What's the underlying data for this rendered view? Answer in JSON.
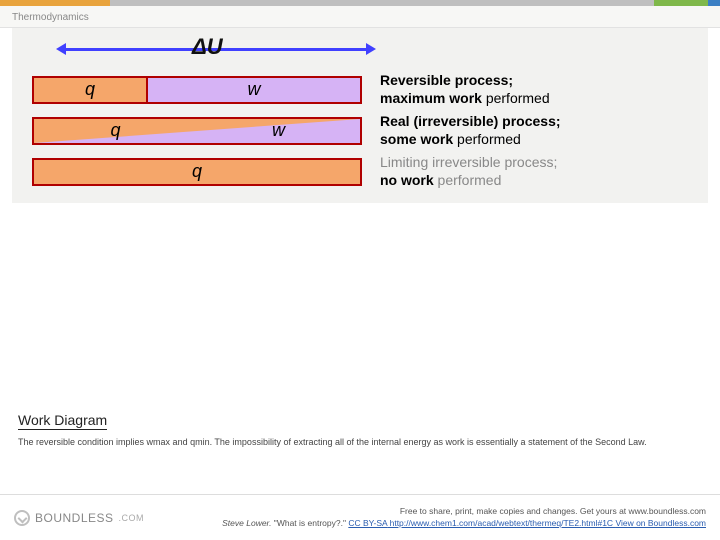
{
  "breadcrumb": "Thermodynamics",
  "du_label": "ΔU",
  "rows": [
    {
      "q": "q",
      "w": "w",
      "desc_bold": "Reversible process;",
      "desc_bold2": "maximum work",
      "desc_tail": " performed"
    },
    {
      "q": "q",
      "w": "w",
      "desc_bold": "Real (irreversible) process;",
      "desc_bold2": "some work",
      "desc_tail": " performed"
    },
    {
      "q": "q",
      "desc_muted1": "Limiting irreversible process;",
      "desc_bold2": "no work",
      "desc_muted2": " performed"
    }
  ],
  "caption": {
    "title": "Work Diagram",
    "text": "The reversible condition implies wmax and qmin. The impossibility of extracting all of the internal energy as work is essentially a statement of the Second Law."
  },
  "footer": {
    "logo_text": "BOUNDLESS",
    "logo_dom": ".COM",
    "line1": "Free to share, print, make copies and changes. Get yours at www.boundless.com",
    "author": "Steve Lower. ",
    "work": "\"What is entropy?.\" ",
    "license": "CC BY-SA",
    "url": " http://www.chem1.com/acad/webtext/thermeq/TE2.html#1C ",
    "view": "View on Boundless.com"
  }
}
